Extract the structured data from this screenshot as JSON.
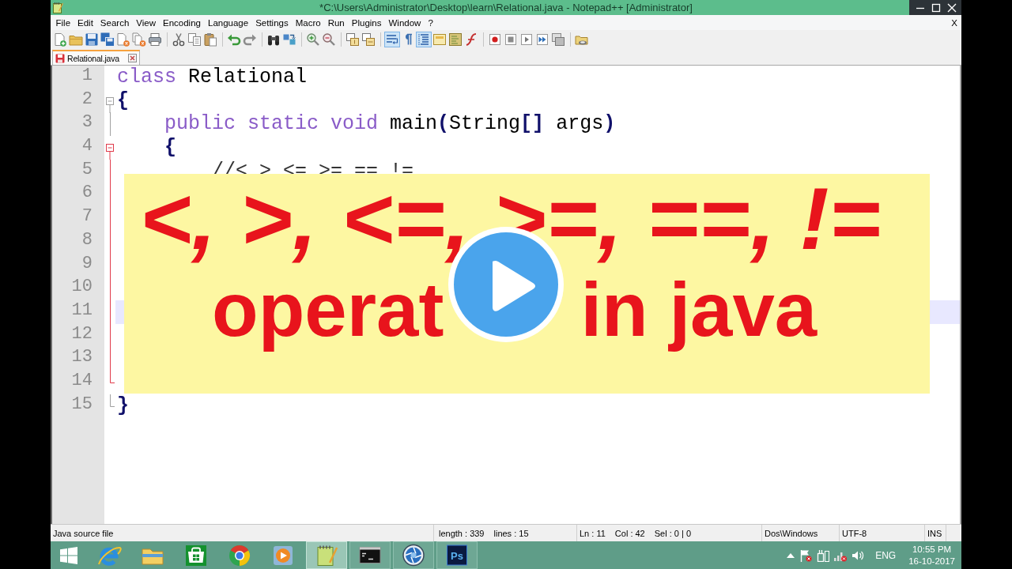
{
  "window": {
    "title": "*C:\\Users\\Administrator\\Desktop\\learn\\Relational.java - Notepad++ [Administrator]"
  },
  "menu": {
    "items": [
      "File",
      "Edit",
      "Search",
      "View",
      "Encoding",
      "Language",
      "Settings",
      "Macro",
      "Run",
      "Plugins",
      "Window",
      "?"
    ],
    "close_document": "X"
  },
  "toolbar": {
    "groups": [
      {
        "buttons": [
          {
            "pressed": false
          },
          {
            "pressed": false
          },
          {
            "pressed": false
          },
          {
            "pressed": false
          },
          {
            "pressed": false
          },
          {
            "pressed": false
          },
          {
            "pressed": false
          }
        ]
      },
      {
        "buttons": [
          {
            "pressed": false
          },
          {
            "pressed": false
          },
          {
            "pressed": false
          }
        ]
      },
      {
        "buttons": [
          {
            "pressed": false
          },
          {
            "pressed": false
          }
        ]
      },
      {
        "buttons": [
          {
            "pressed": false
          },
          {
            "pressed": false
          }
        ]
      },
      {
        "buttons": [
          {
            "pressed": false
          },
          {
            "pressed": false
          }
        ]
      },
      {
        "buttons": [
          {
            "pressed": false
          },
          {
            "pressed": false
          }
        ]
      },
      {
        "buttons": [
          {
            "pressed": true
          },
          {
            "pressed": false
          },
          {
            "pressed": true
          },
          {
            "pressed": false
          },
          {
            "pressed": false
          },
          {
            "pressed": false
          }
        ]
      },
      {
        "buttons": [
          {
            "pressed": false
          },
          {
            "pressed": false
          },
          {
            "pressed": false
          },
          {
            "pressed": false
          },
          {
            "pressed": false
          }
        ]
      },
      {
        "buttons": [
          {
            "pressed": false
          }
        ]
      }
    ]
  },
  "tabs": [
    {
      "label": "Relational.java",
      "selected": true,
      "modified": true
    }
  ],
  "editor": {
    "lines": [
      {
        "number": "1",
        "current": false,
        "tokens": [
          {
            "kind": "keyword",
            "text": "class"
          },
          {
            "kind": "plain",
            "text": " Relational"
          }
        ]
      },
      {
        "number": "2",
        "current": false,
        "fold": {
          "kind": "start",
          "active": false
        },
        "tokens": [
          {
            "kind": "operator",
            "text": "{"
          }
        ]
      },
      {
        "number": "3",
        "current": false,
        "fold": {
          "kind": "body",
          "active": false
        },
        "tokens": [
          {
            "kind": "keyword",
            "text": "    public static void"
          },
          {
            "kind": "plain",
            "text": " main"
          },
          {
            "kind": "operator",
            "text": "("
          },
          {
            "kind": "plain",
            "text": "String"
          },
          {
            "kind": "operator",
            "text": "[]"
          },
          {
            "kind": "plain",
            "text": " args"
          },
          {
            "kind": "operator",
            "text": ")"
          }
        ]
      },
      {
        "number": "4",
        "current": false,
        "fold": {
          "kind": "start",
          "active": true
        },
        "tokens": [
          {
            "kind": "operator",
            "text": "    {"
          }
        ]
      },
      {
        "number": "5",
        "current": false,
        "fold": {
          "kind": "body",
          "active": true
        },
        "tokens": [
          {
            "kind": "comment",
            "text": "        //< > <= >= == !="
          }
        ]
      },
      {
        "number": "6",
        "current": false,
        "fold": {
          "kind": "body",
          "active": true
        }
      },
      {
        "number": "7",
        "current": false,
        "fold": {
          "kind": "body",
          "active": true
        }
      },
      {
        "number": "8",
        "current": false,
        "fold": {
          "kind": "body",
          "active": true
        }
      },
      {
        "number": "9",
        "current": false,
        "fold": {
          "kind": "body",
          "active": true
        }
      },
      {
        "number": "10",
        "current": false,
        "fold": {
          "kind": "body",
          "active": true
        }
      },
      {
        "number": "11",
        "current": true,
        "fold": {
          "kind": "body",
          "active": true
        }
      },
      {
        "number": "12",
        "current": false,
        "fold": {
          "kind": "body",
          "active": true
        }
      },
      {
        "number": "13",
        "current": false,
        "fold": {
          "kind": "body",
          "active": true
        }
      },
      {
        "number": "14",
        "current": false,
        "fold": {
          "kind": "end",
          "active": true
        }
      },
      {
        "number": "15",
        "current": false,
        "fold": {
          "kind": "end",
          "active": false
        },
        "tokens": [
          {
            "kind": "operator",
            "text": "}"
          }
        ]
      }
    ]
  },
  "banner": {
    "headline": "<, >, <=, >=, ==, !=",
    "subtitle": [
      "operat",
      "in java"
    ]
  },
  "status_bar": {
    "file_type": "Java source file",
    "length": "length : 339",
    "lines": "lines : 15",
    "line": "Ln : 11",
    "column": "Col : 42",
    "selection": "Sel : 0 | 0",
    "eol": "Dos\\Windows",
    "encoding": "UTF-8",
    "mode": "INS"
  },
  "taskbar": {
    "apps": [
      {
        "running": false,
        "selected": false
      },
      {
        "running": false,
        "selected": false
      },
      {
        "running": false,
        "selected": false
      },
      {
        "running": false,
        "selected": false
      },
      {
        "running": false,
        "selected": false
      },
      {
        "running": true,
        "selected": true
      },
      {
        "running": true,
        "selected": false
      },
      {
        "running": true,
        "selected": false
      },
      {
        "running": true,
        "selected": false,
        "text": "Ps"
      }
    ],
    "tray": {
      "language": "ENG",
      "time": "10:55 PM",
      "date": "16-10-2017"
    }
  }
}
